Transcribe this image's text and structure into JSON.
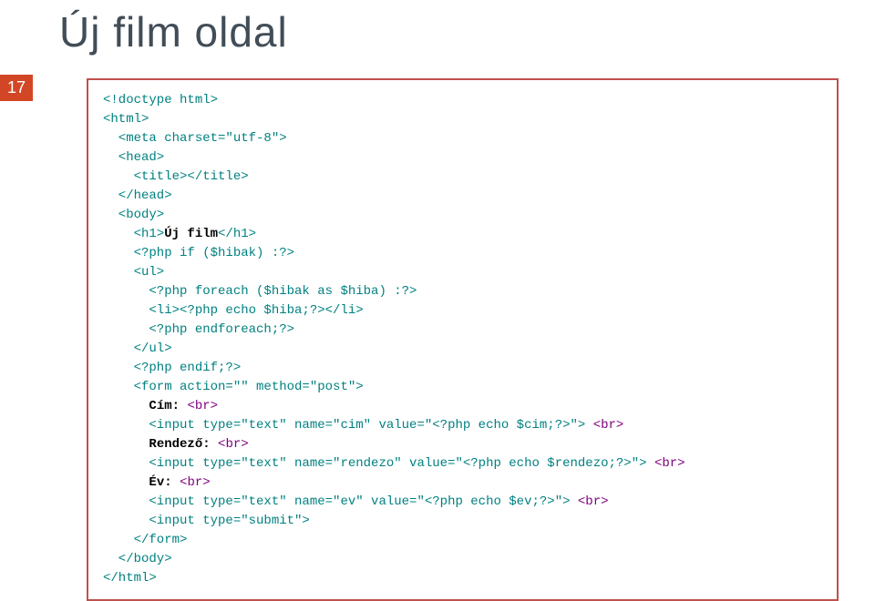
{
  "pageNumber": "17",
  "title": "Új film oldal",
  "code": {
    "l1_a": "<!doctype html>",
    "l2_a": "<html>",
    "l3_a": "  <meta charset=\"utf-8\">",
    "l4_a": "  <head>",
    "l5_a": "    <title></title>",
    "l6_a": "  </head>",
    "l7_a": "  <body>",
    "l8_a": "    <h1>",
    "l8_b": "Új film",
    "l8_c": "</h1>",
    "l9_a": "    <?php if ($hibak) :?>",
    "l10_a": "    <ul>",
    "l11_a": "      <?php foreach ($hibak as $hiba) :?>",
    "l12_a": "      <li><?php echo $hiba;?></li>",
    "l13_a": "      <?php endforeach;?>",
    "l14_a": "    </ul>",
    "l15_a": "    <?php endif;?>",
    "l16_a": "    <form action=\"\" method=\"post\">",
    "l17_a": "      ",
    "l17_b": "Cím:",
    "l17_c": " ",
    "l17_d": "<br>",
    "l18_a": "      <input type=\"text\" name=\"cim\" value=\"",
    "l18_b": "<?php echo $cim;?>",
    "l18_c": "\"> ",
    "l18_d": "<br>",
    "l19_a": "      ",
    "l19_b": "Rendező:",
    "l19_c": " ",
    "l19_d": "<br>",
    "l20_a": "      <input type=\"text\" name=\"rendezo\" value=\"",
    "l20_b": "<?php echo $rendezo;?>",
    "l20_c": "\"> ",
    "l20_d": "<br>",
    "l21_a": "      ",
    "l21_b": "Év:",
    "l21_c": " ",
    "l21_d": "<br>",
    "l22_a": "      <input type=\"text\" name=\"ev\" value=\"",
    "l22_b": "<?php echo $ev;?>",
    "l22_c": "\"> ",
    "l22_d": "<br>",
    "l23_a": "      <input type=\"submit\">",
    "l24_a": "    </form>",
    "l25_a": "  </body>",
    "l26_a": "</html>"
  }
}
